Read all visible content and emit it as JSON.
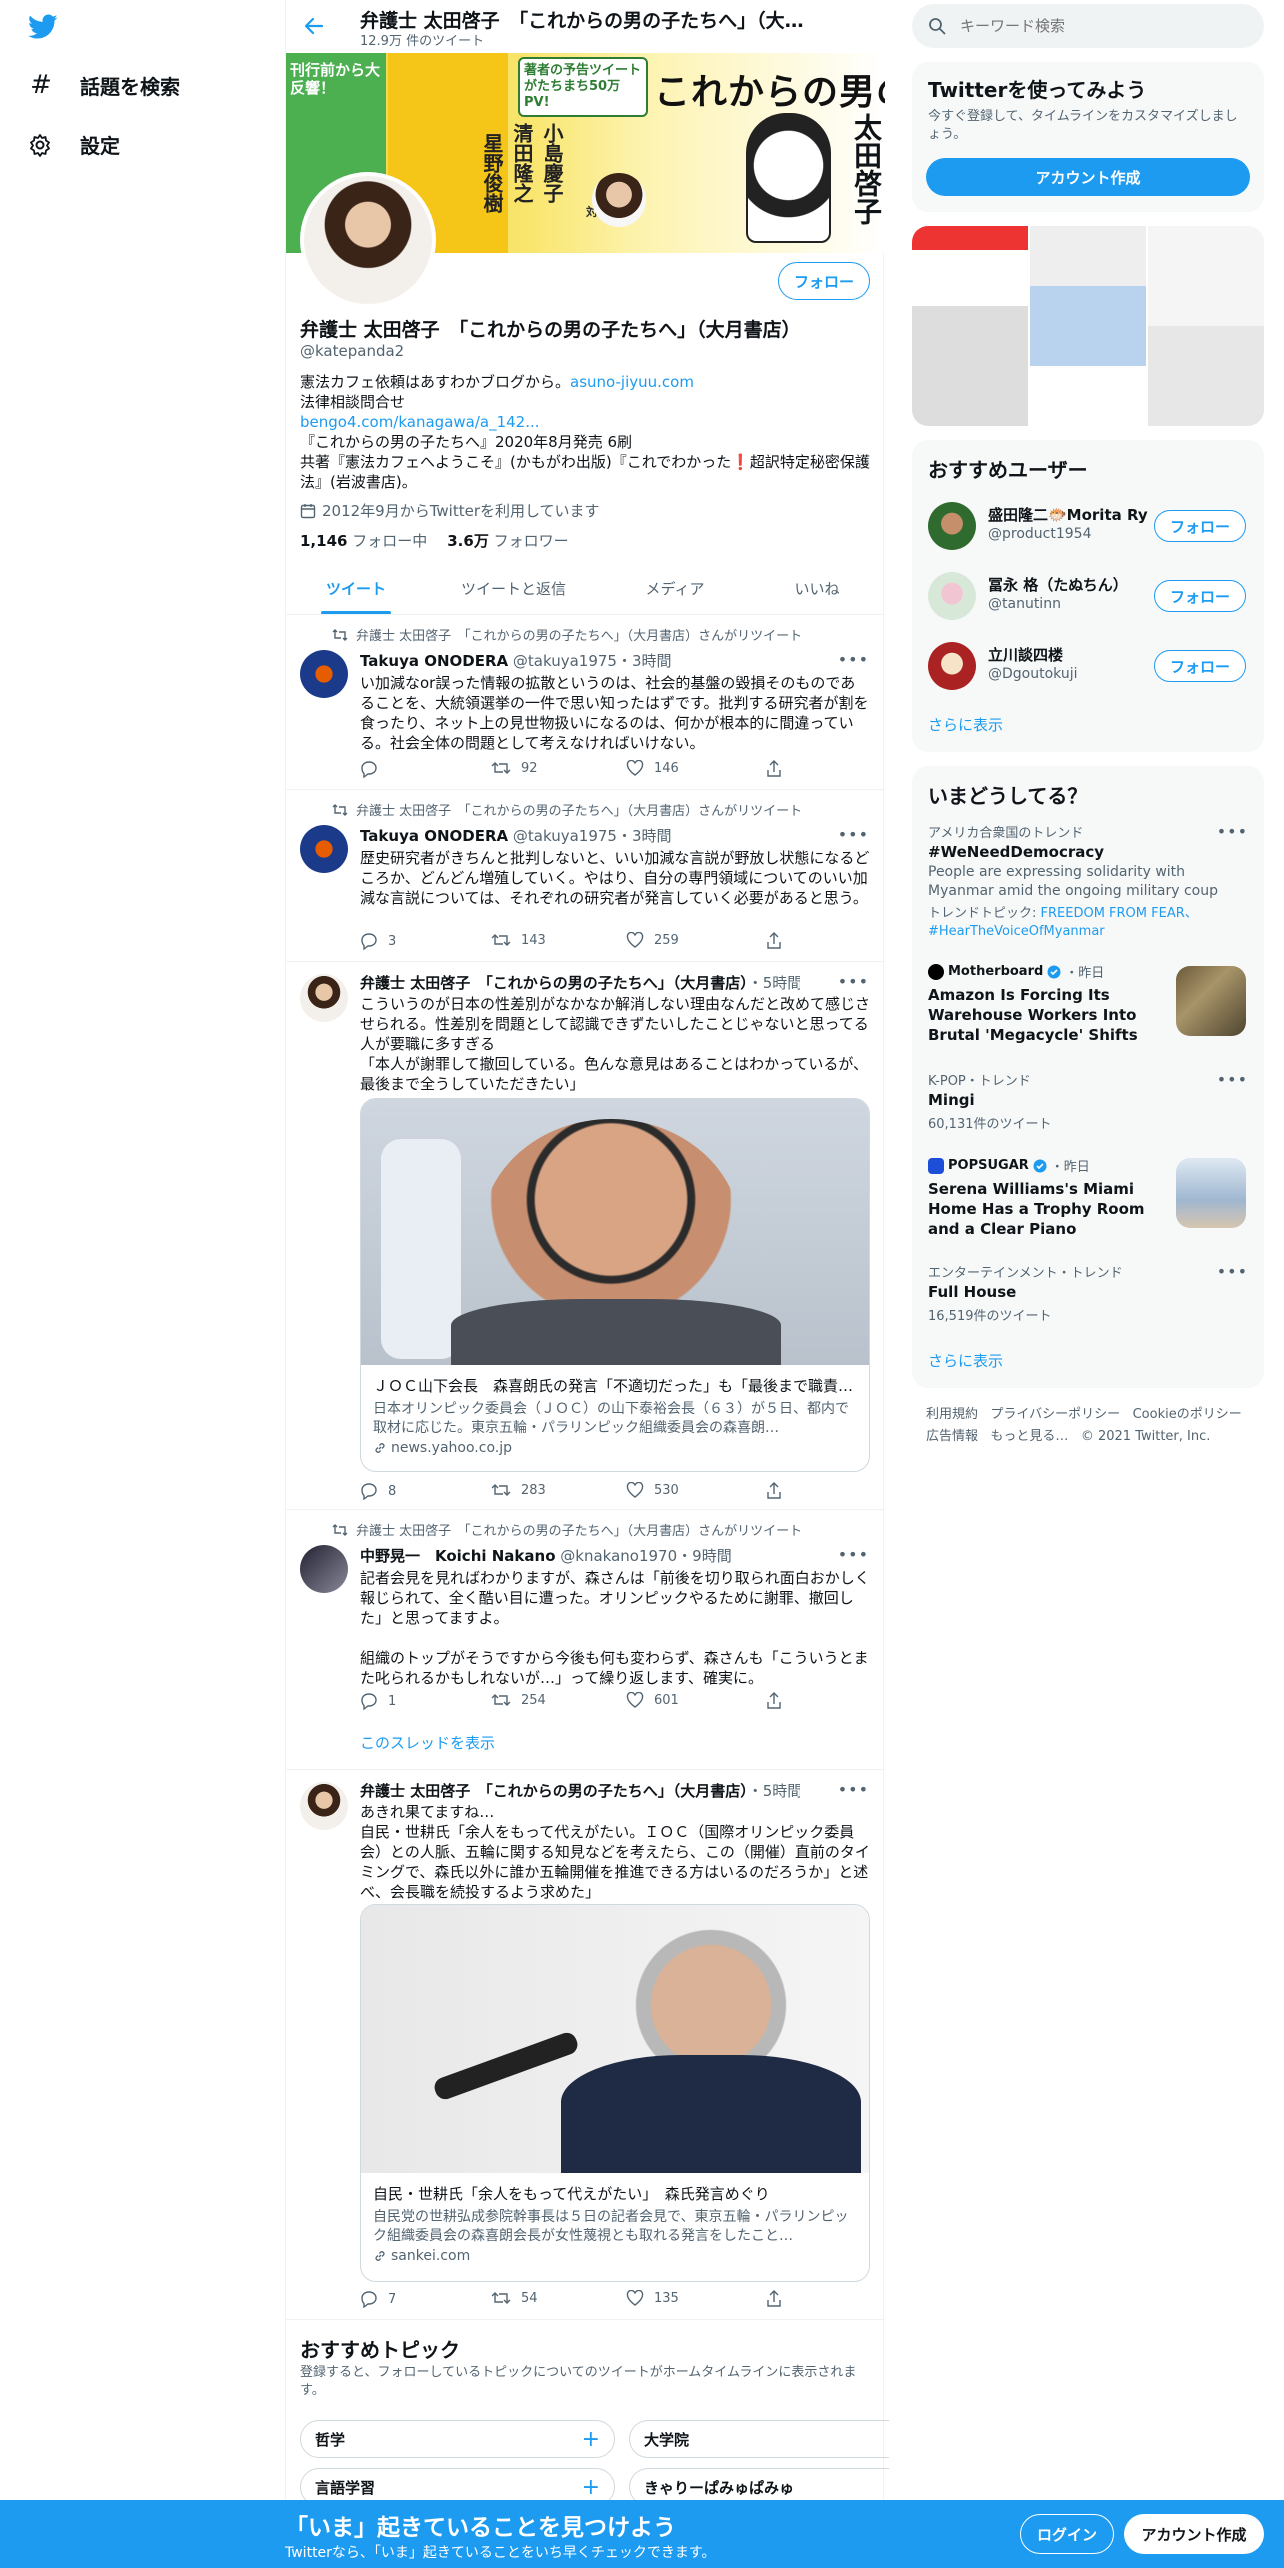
{
  "nav": {
    "explore_label": "話題を検索",
    "settings_label": "設定"
  },
  "header": {
    "name": "弁護士 太田啓子　「これからの男の子たちへ」（大…",
    "tweet_count": "12.9万 件のツイート"
  },
  "banner": {
    "title": "これからの男の子たちへ",
    "badge1": "刊行前から大反響！",
    "badge2": "著者の予告ツイートがたちまち50万PV!",
    "author_big": "太田啓子",
    "guest1": "小島慶子",
    "guest2": "清田隆之",
    "guest3": "星野俊樹",
    "taidan": "対談"
  },
  "profile": {
    "follow_label": "フォロー",
    "display_name": "弁護士 太田啓子　「これからの男の子たちへ」（大月書店）",
    "handle": "@katepanda2",
    "bio_line1": "憲法カフェ依頼はあすわかブログから。",
    "bio_link1": "asuno-jiyuu.com",
    "bio_line2": "法律相談問合せ",
    "bio_link2": "bengo4.com/kanagawa/a_142...",
    "bio_line3": "『これからの男の子たちへ』2020年8月発売 6刷",
    "bio_line4": "共著『憲法カフェへようこそ』(かもがわ出版)『これでわかった❗️超訳特定秘密保護法』(岩波書店)。",
    "joined": "2012年9月からTwitterを利用しています",
    "following_count": "1,146",
    "following_label": "フォロー中",
    "followers_count": "3.6万",
    "followers_label": "フォロワー"
  },
  "tabs": [
    "ツイート",
    "ツイートと返信",
    "メディア",
    "いいね"
  ],
  "tweets": [
    {
      "retweet_note": "弁護士 太田啓子　「これからの男の子たちへ」（大月書店）さんがリツイート",
      "name": "Takuya ONODERA",
      "handle": "@takuya1975",
      "time": "3時間",
      "text": "い加減なor誤った情報の拡散というのは、社会的基盤の毀損そのものであることを、大統領選挙の一件で思い知ったはずです。批判する研究者が割を食ったり、ネット上の見世物扱いになるのは、何かが根本的に間違っている。社会全体の問題として考えなければいけない。",
      "reply": "",
      "retweets": "92",
      "likes": "146"
    },
    {
      "retweet_note": "弁護士 太田啓子　「これからの男の子たちへ」（大月書店）さんがリツイート",
      "name": "Takuya ONODERA",
      "handle": "@takuya1975",
      "time": "3時間",
      "text": "歴史研究者がきちんと批判しないと、いい加減な言説が野放し状態になるどころか、どんどん増殖していく。やはり、自分の専門領域についてのいい加減な言説については、それぞれの研究者が発言していく必要があると思う。",
      "reply": "3",
      "retweets": "143",
      "likes": "259"
    },
    {
      "name": "弁護士 太田啓子　「これからの男の子たちへ」（大月書店）",
      "time": "5時間",
      "text": "こういうのが日本の性差別がなかなか解消しない理由なんだと改めて感じさせられる。性差別を問題として認識できずたいしたことじゃないと思ってる人が要職に多すぎる\n「本人が謝罪して撤回している。色んな意見はあることはわかっているが、最後まで全うしていただきたい」",
      "card_title": "ＪＯＣ山下会長　森喜朗氏の発言「不適切だった」も「最後まで職責…",
      "card_desc": "日本オリンピック委員会（ＪＯＣ）の山下泰裕会長（６３）が５日、都内で取材に応じた。東京五輪・パラリンピック組織委員会の森喜朗…",
      "card_domain": "news.yahoo.co.jp",
      "reply": "8",
      "retweets": "283",
      "likes": "530"
    },
    {
      "retweet_note": "弁護士 太田啓子　「これからの男の子たちへ」（大月書店）さんがリツイート",
      "name": "中野晃一　Koichi Nakano",
      "handle": "@knakano1970",
      "time": "9時間",
      "text": "記者会見を見ればわかりますが、森さんは「前後を切り取られ面白おかしく報じられて、全く酷い目に遭った。オリンピックやるために謝罪、撤回した」と思ってますよ。\n\n組織のトップがそうですから今後も何も変わらず、森さんも「こういうとまた叱られるかもしれないが…」って繰り返します、確実に。",
      "reply": "1",
      "retweets": "254",
      "likes": "601",
      "thread_link": "このスレッドを表示"
    },
    {
      "name": "弁護士 太田啓子　「これからの男の子たちへ」（大月書店）",
      "time": "5時間",
      "text": "あきれ果てますね…\n自民・世耕氏「余人をもって代えがたい。ＩＯＣ（国際オリンピック委員会）との人脈、五輪に関する知見などを考えたら、この（開催）直前のタイミングで、森氏以外に誰か五輪開催を推進できる方はいるのだろうか」と述べ、会長職を続投するよう求めた」",
      "card_title": "自民・世耕氏「余人をもって代えがたい」　森氏発言めぐり",
      "card_desc": "自民党の世耕弘成参院幹事長は５日の記者会見で、東京五輪・パラリンピック組織委員会の森喜朗会長が女性蔑視とも取れる発言をしたこと…",
      "card_domain": "sankei.com",
      "reply": "7",
      "retweets": "54",
      "likes": "135"
    }
  ],
  "topics": {
    "title": "おすすめトピック",
    "subtitle": "登録すると、フォローしているトピックについてのツイートがホームタイムラインに表示されます。",
    "items": [
      "哲学",
      "大学院",
      "言語学習",
      "きゃりーぱみゅぱみゅ"
    ]
  },
  "search": {
    "placeholder": "キーワード検索"
  },
  "signup": {
    "title": "Twitterを使ってみよう",
    "subtitle": "今すぐ登録して、タイムラインをカスタマイズしましょう。",
    "button": "アカウント作成"
  },
  "who_to_follow": {
    "title": "おすすめユーザー",
    "users": [
      {
        "name": "盛田隆二🐡Morita Ry…",
        "handle": "@product1954",
        "button": "フォロー"
      },
      {
        "name": "冨永 格（たぬちん）",
        "handle": "@tanutinn",
        "button": "フォロー"
      },
      {
        "name": "立川談四楼",
        "handle": "@Dgoutokuji",
        "button": "フォロー"
      }
    ],
    "show_more": "さらに表示"
  },
  "trends": {
    "title": "いまどうしてる？",
    "items": [
      {
        "meta": "アメリカ合衆国のトレンド",
        "name": "#WeNeedDemocracy",
        "desc": "People are expressing solidarity with Myanmar amid the ongoing military coup",
        "related_label": "トレンドトピック: ",
        "related": "FREEDOM FROM FEAR、#HearTheVoiceOfMyanmar"
      },
      {
        "meta_source": "Motherboard",
        "meta_time": "・昨日",
        "name": "Amazon Is Forcing Its Warehouse Workers Into Brutal 'Megacycle' Shifts"
      },
      {
        "meta": "K-POP・トレンド",
        "name": "Mingi",
        "count": "60,131件のツイート"
      },
      {
        "meta_source": "POPSUGAR",
        "meta_time": "・昨日",
        "name": "Serena Williams's Miami Home Has a Trophy Room and a Clear Piano"
      },
      {
        "meta": "エンターテインメント・トレンド",
        "name": "Full House",
        "count": "16,519件のツイート"
      }
    ],
    "show_more": "さらに表示"
  },
  "footer": {
    "links": [
      "利用規約",
      "プライバシーポリシー",
      "Cookieのポリシー",
      "広告情報",
      "もっと見る…",
      "© 2021 Twitter, Inc."
    ]
  },
  "bottombar": {
    "title": "「いま」起きていることを見つけよう",
    "subtitle": "Twitterなら、「いま」起きていることをいち早くチェックできます。",
    "login": "ログイン",
    "signup": "アカウント作成"
  },
  "colors": {
    "accent": "#1d9bf0",
    "text": "#0f1419",
    "muted": "#536471"
  }
}
